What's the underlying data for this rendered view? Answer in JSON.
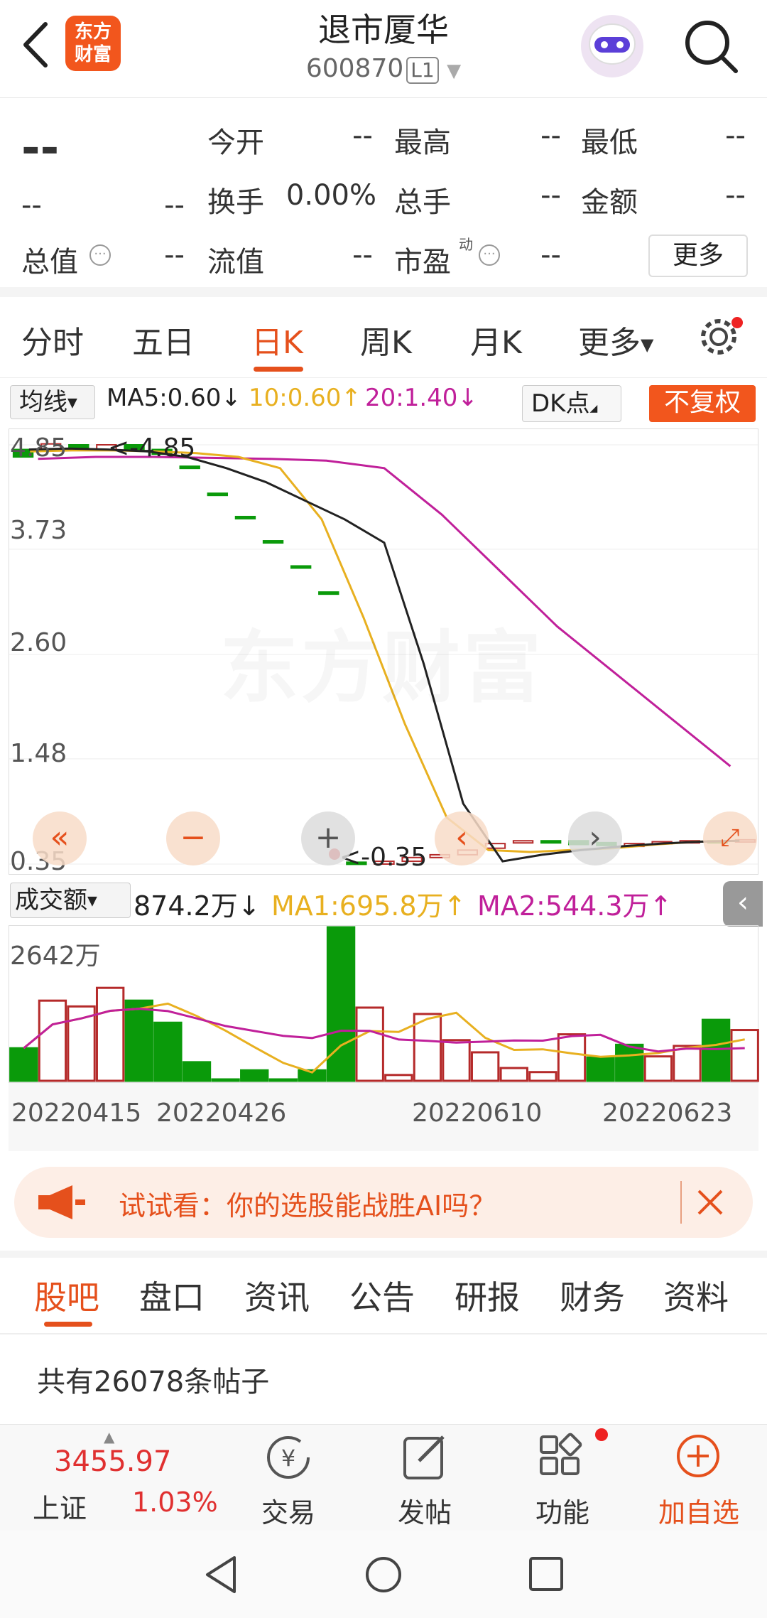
{
  "header": {
    "title": "退市厦华",
    "code": "600870",
    "level": "L1",
    "logo_line1": "东方",
    "logo_line2": "财富"
  },
  "quote": {
    "price": "--",
    "change": "--",
    "change_pct": "--",
    "open_label": "今开",
    "open": "--",
    "high_label": "最高",
    "high": "--",
    "low_label": "最低",
    "low": "--",
    "turnover_label": "换手",
    "turnover": "0.00%",
    "volume_label": "总手",
    "volume": "--",
    "amount_label": "金额",
    "amount": "--",
    "mktcap_label": "总值",
    "mktcap": "--",
    "float_label": "流值",
    "float": "--",
    "pe_label": "市盈",
    "pe_sup": "动",
    "pe": "--",
    "more_label": "更多"
  },
  "tabs": [
    {
      "label": "分时"
    },
    {
      "label": "五日"
    },
    {
      "label": "日K"
    },
    {
      "label": "周K"
    },
    {
      "label": "月K"
    },
    {
      "label": "更多"
    }
  ],
  "indicators": {
    "ma_selector": "均线",
    "ma5": "MA5:0.60↓",
    "ma10": "10:0.60↑",
    "ma20": "20:1.40↓",
    "dk_label": "DK点",
    "adjust_label": "不复权",
    "ma5_color": "#222222",
    "ma10_color": "#e8b020",
    "ma20_color": "#c0209a"
  },
  "chart_data": {
    "type": "candlestick",
    "y_ticks": [
      "4.85",
      "3.73",
      "2.60",
      "1.48",
      "0.35"
    ],
    "ylim": [
      0.35,
      4.85
    ],
    "max_label": "<-4.85",
    "min_label": "<-0.35",
    "watermark": "东方财富",
    "candles": [
      {
        "o": 4.8,
        "c": 4.72,
        "up": false
      },
      {
        "o": 4.8,
        "c": 4.86,
        "up": true
      },
      {
        "o": 4.85,
        "c": 4.8,
        "up": false
      },
      {
        "o": 4.8,
        "c": 4.85,
        "up": true
      },
      {
        "o": 4.85,
        "c": 4.8,
        "up": false
      },
      {
        "o": 4.8,
        "c": 4.75,
        "up": false
      },
      {
        "o": 4.62,
        "c": 4.62,
        "up": false
      },
      {
        "o": 4.33,
        "c": 4.33,
        "up": false
      },
      {
        "o": 4.08,
        "c": 4.08,
        "up": false
      },
      {
        "o": 3.82,
        "c": 3.82,
        "up": false
      },
      {
        "o": 3.55,
        "c": 3.55,
        "up": false
      },
      {
        "o": 3.27,
        "c": 3.27,
        "up": false
      },
      {
        "o": 0.37,
        "c": 0.37,
        "up": false
      },
      {
        "o": 0.35,
        "c": 0.38,
        "up": true
      },
      {
        "o": 0.38,
        "c": 0.42,
        "up": true
      },
      {
        "o": 0.42,
        "c": 0.45,
        "up": true
      },
      {
        "o": 0.45,
        "c": 0.5,
        "up": true
      },
      {
        "o": 0.52,
        "c": 0.57,
        "up": true
      },
      {
        "o": 0.6,
        "c": 0.6,
        "up": true
      },
      {
        "o": 0.6,
        "c": 0.6,
        "up": false
      },
      {
        "o": 0.6,
        "c": 0.56,
        "up": false
      },
      {
        "o": 0.58,
        "c": 0.55,
        "up": false
      },
      {
        "o": 0.54,
        "c": 0.57,
        "up": true
      },
      {
        "o": 0.57,
        "c": 0.59,
        "up": true
      },
      {
        "o": 0.59,
        "c": 0.6,
        "up": true
      },
      {
        "o": 0.6,
        "c": 0.59,
        "up": false
      },
      {
        "o": 0.6,
        "c": 0.61,
        "up": true
      }
    ],
    "ma5": [
      4.8,
      4.81,
      4.8,
      4.78,
      4.72,
      4.6,
      4.45,
      4.25,
      4.05,
      3.8,
      2.5,
      1.0,
      0.38,
      0.45,
      0.5,
      0.54,
      0.57,
      0.59,
      0.6
    ],
    "ma10": [
      4.78,
      4.79,
      4.79,
      4.78,
      4.76,
      4.72,
      4.6,
      4.05,
      3.0,
      1.85,
      0.85,
      0.5,
      0.48,
      0.5,
      0.52,
      0.56,
      0.59,
      0.6
    ],
    "ma20": [
      4.7,
      4.72,
      4.72,
      4.71,
      4.7,
      4.68,
      4.6,
      4.1,
      3.5,
      2.9,
      2.4,
      1.9,
      1.4
    ]
  },
  "volume": {
    "selector": "成交额",
    "current": "874.2万↓",
    "ma1": "MA1:695.8万↑",
    "ma2": "MA2:544.3万↑",
    "max_label": "2642万",
    "ma1_color": "#e8b020",
    "ma2_color": "#c0209a",
    "values": [
      560,
      1380,
      1280,
      1600,
      1380,
      1000,
      320,
      20,
      180,
      20,
      180,
      2642,
      1260,
      100,
      1150,
      700,
      490,
      220,
      150,
      800,
      400,
      620,
      420,
      600,
      1050,
      874
    ],
    "up": [
      false,
      true,
      true,
      true,
      false,
      false,
      false,
      false,
      false,
      false,
      false,
      false,
      true,
      true,
      true,
      true,
      true,
      true,
      true,
      true,
      false,
      false,
      true,
      true,
      false,
      true
    ]
  },
  "dates": [
    "20220415",
    "20220426",
    "20220610",
    "20220623"
  ],
  "ad": {
    "text": "试试看：你的选股能战胜AI吗？"
  },
  "subtabs": [
    {
      "label": "股吧"
    },
    {
      "label": "盘口"
    },
    {
      "label": "资讯"
    },
    {
      "label": "公告"
    },
    {
      "label": "研报"
    },
    {
      "label": "财务"
    },
    {
      "label": "资料"
    }
  ],
  "post_count": "共有26078条帖子",
  "bottom": {
    "index_value": "3455.97",
    "index_name": "上证",
    "index_pct": "1.03%",
    "trade": "交易",
    "post": "发帖",
    "func": "功能",
    "add": "加自选"
  }
}
